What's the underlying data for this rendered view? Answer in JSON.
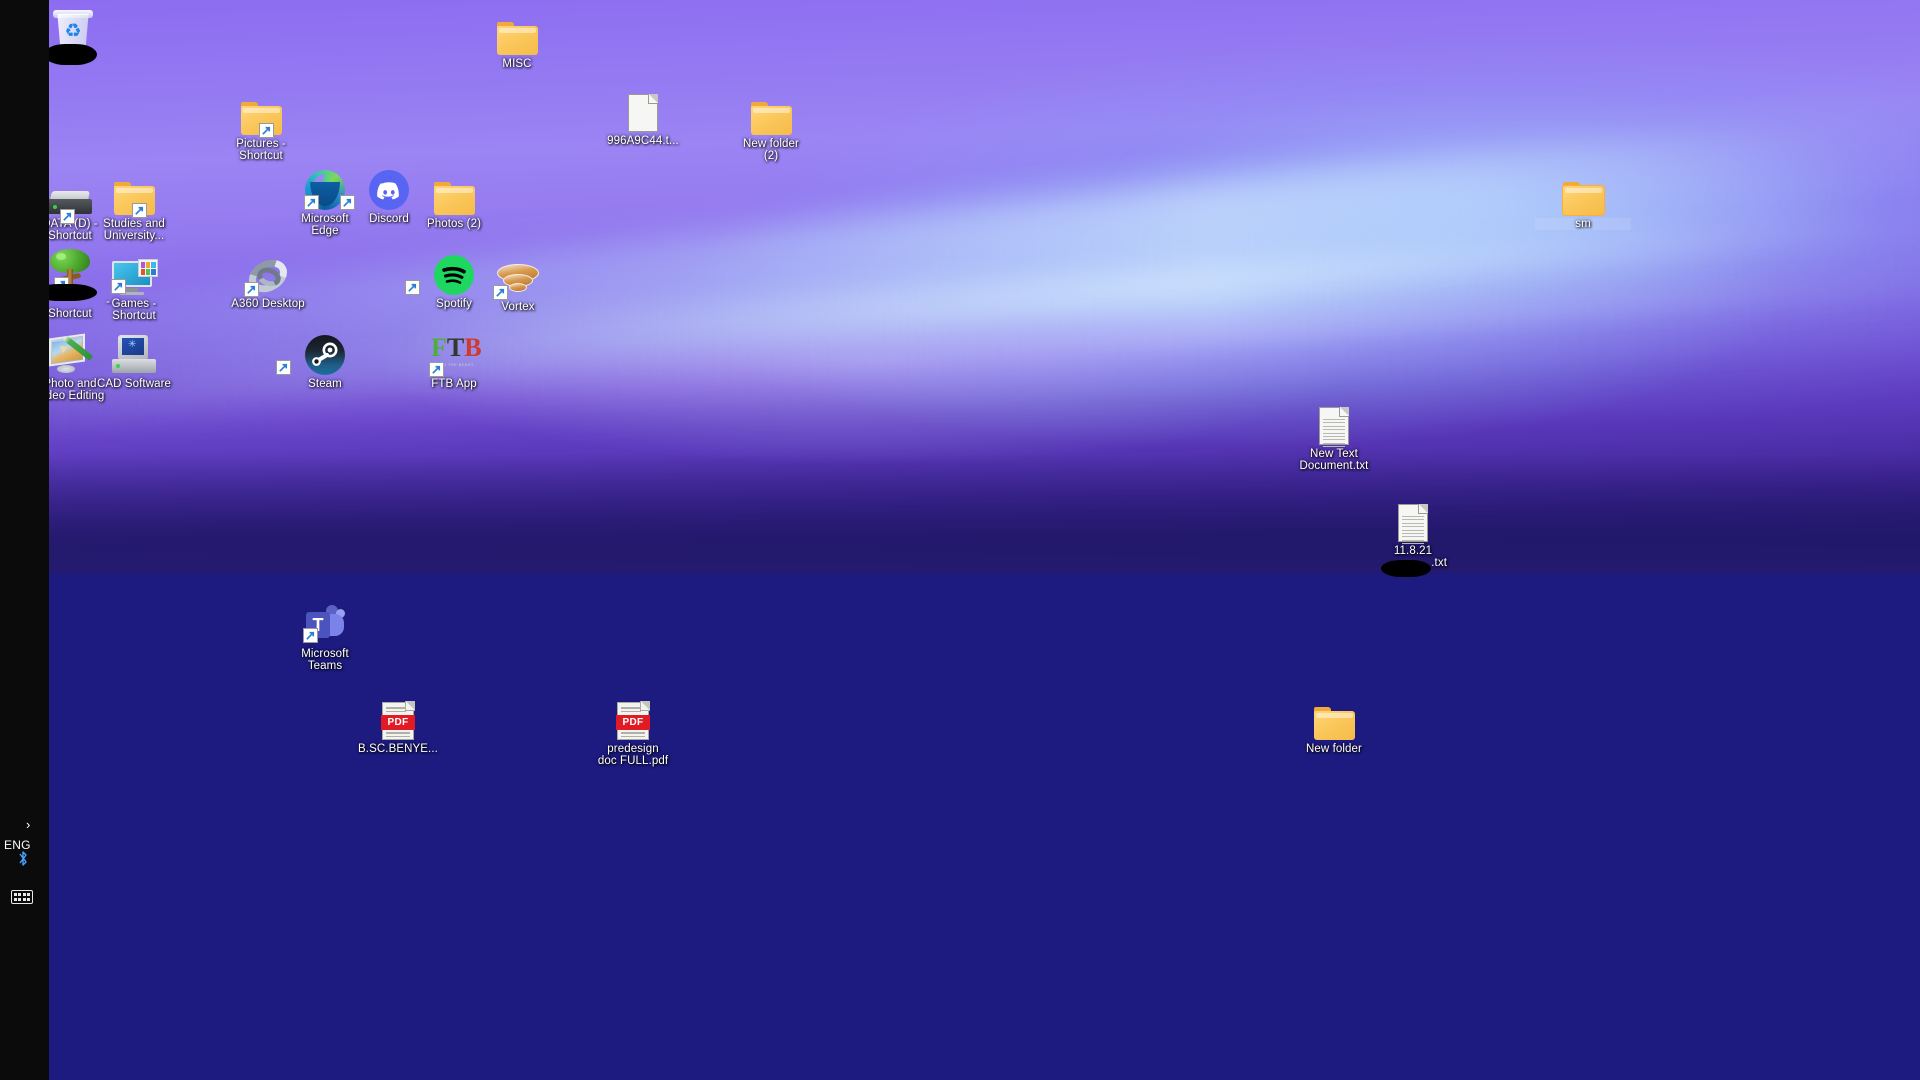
{
  "desktop": {
    "wallpaper_top_color": "#9b84f3",
    "wallpaper_bottom_color": "#1d1b80",
    "left_bar_color": "#0b0b0b",
    "icons": [
      {
        "id": "recycle-bin",
        "name": "Recycle Bin",
        "label": "",
        "redacted": true,
        "type": "system"
      },
      {
        "id": "misc",
        "name": "MISC",
        "label": "MISC",
        "type": "folder"
      },
      {
        "id": "pictures",
        "name": "Pictures - Shortcut",
        "label": "Pictures - Shortcut",
        "type": "folder",
        "shortcut": true
      },
      {
        "id": "txtfile-996",
        "name": "996A9C44.txt",
        "label": "996A9C44.t...",
        "type": "file"
      },
      {
        "id": "new-folder-2",
        "name": "New folder (2)",
        "label": "New folder (2)",
        "type": "folder"
      },
      {
        "id": "data-d",
        "name": "DATA (D) - Shortcut",
        "label": "DATA (D) - Shortcut",
        "type": "drive",
        "shortcut": true
      },
      {
        "id": "studies",
        "name": "Studies and University",
        "label": "Studies and University...",
        "type": "folder",
        "shortcut": true
      },
      {
        "id": "edge",
        "name": "Microsoft Edge",
        "label": "Microsoft Edge",
        "type": "app",
        "shortcut": true
      },
      {
        "id": "discord",
        "name": "Discord",
        "label": "Discord",
        "type": "app",
        "shortcut": true
      },
      {
        "id": "photos-2",
        "name": "Photos (2)",
        "label": "Photos (2)",
        "type": "folder"
      },
      {
        "id": "sm",
        "name": "sm",
        "label": "sm",
        "type": "folder",
        "selected": true
      },
      {
        "id": "tree-shortcut",
        "name": "Shortcut",
        "label": "Shortcut",
        "label_top": "-",
        "redacted": true,
        "type": "app",
        "shortcut": true
      },
      {
        "id": "games",
        "name": "Games - Shortcut",
        "label": "Games - Shortcut",
        "type": "folder",
        "shortcut": true
      },
      {
        "id": "a360",
        "name": "A360 Desktop",
        "label": "A360 Desktop",
        "type": "app",
        "shortcut": true
      },
      {
        "id": "spotify",
        "name": "Spotify",
        "label": "Spotify",
        "type": "app",
        "shortcut": true
      },
      {
        "id": "vortex",
        "name": "Vortex",
        "label": "Vortex",
        "type": "app",
        "shortcut": true
      },
      {
        "id": "photo-video",
        "name": "Photo and Video Editing",
        "label": "Photo and Video Editing",
        "type": "app"
      },
      {
        "id": "cad-software",
        "name": "CAD Software",
        "label": "CAD Software",
        "type": "app"
      },
      {
        "id": "steam",
        "name": "Steam",
        "label": "Steam",
        "type": "app",
        "shortcut": true
      },
      {
        "id": "ftb-app",
        "name": "FTB App",
        "label": "FTB App",
        "type": "app",
        "shortcut": true
      },
      {
        "id": "new-text-doc",
        "name": "New Text Document.txt",
        "label": "New Text Document.txt",
        "type": "file"
      },
      {
        "id": "dated-txt",
        "name": "11.8.21 .txt",
        "label": "11.8.21",
        "label_bottom": ".txt",
        "redacted": true,
        "type": "file"
      },
      {
        "id": "ms-teams",
        "name": "Microsoft Teams",
        "label": "Microsoft Teams",
        "type": "app",
        "shortcut": true
      },
      {
        "id": "bsc-pdf",
        "name": "B.SC.BENYE....pdf",
        "label": "B.SC.BENYE...",
        "type": "pdf"
      },
      {
        "id": "predesign-pdf",
        "name": "predesign doc FULL.pdf",
        "label": "predesign doc FULL.pdf",
        "type": "pdf"
      },
      {
        "id": "new-folder",
        "name": "New folder",
        "label": "New folder",
        "type": "folder"
      }
    ]
  },
  "labels": {
    "recycle_bin": "",
    "misc": "MISC",
    "pictures": "Pictures -",
    "pictures2": "Shortcut",
    "txt996": "996A9C44.t...",
    "newfolder2": "New folder",
    "newfolder2b": "(2)",
    "data_d": "DATA (D) -",
    "data_d2": "Shortcut",
    "studies": "Studies and",
    "studies2": "University...",
    "edge": "Microsoft",
    "edge2": "Edge",
    "discord": "Discord",
    "photos2": "Photos (2)",
    "sm": "sm",
    "tree_dash": "-",
    "tree_shortcut": "Shortcut",
    "games": "Games -",
    "games2": "Shortcut",
    "a360": "A360 Desktop",
    "spotify": "Spotify",
    "vortex": "Vortex",
    "photovideo": "Photo and",
    "photovideo2": "Video Editing",
    "cad": "CAD Software",
    "steam": "Steam",
    "ftb": "FTB App",
    "newtextdoc": "New Text",
    "newtextdoc2": "Document.txt",
    "dated": "11.8.21",
    "dated_ext": ".txt",
    "teams": "Microsoft",
    "teams2": "Teams",
    "bsc": "B.SC.BENYE...",
    "predesign": "predesign",
    "predesign2": "doc FULL.pdf",
    "newfolder": "New folder",
    "ftb_f": "F",
    "ftb_t": "T",
    "ftb_b": "B",
    "ftb_sub": "FEED THE BEAST",
    "teams_t": "T"
  },
  "taskbar": {
    "language": "ENG",
    "chevron": "›",
    "bluetooth_icon": "bluetooth-icon",
    "keyboard_icon": "keyboard-icon"
  }
}
